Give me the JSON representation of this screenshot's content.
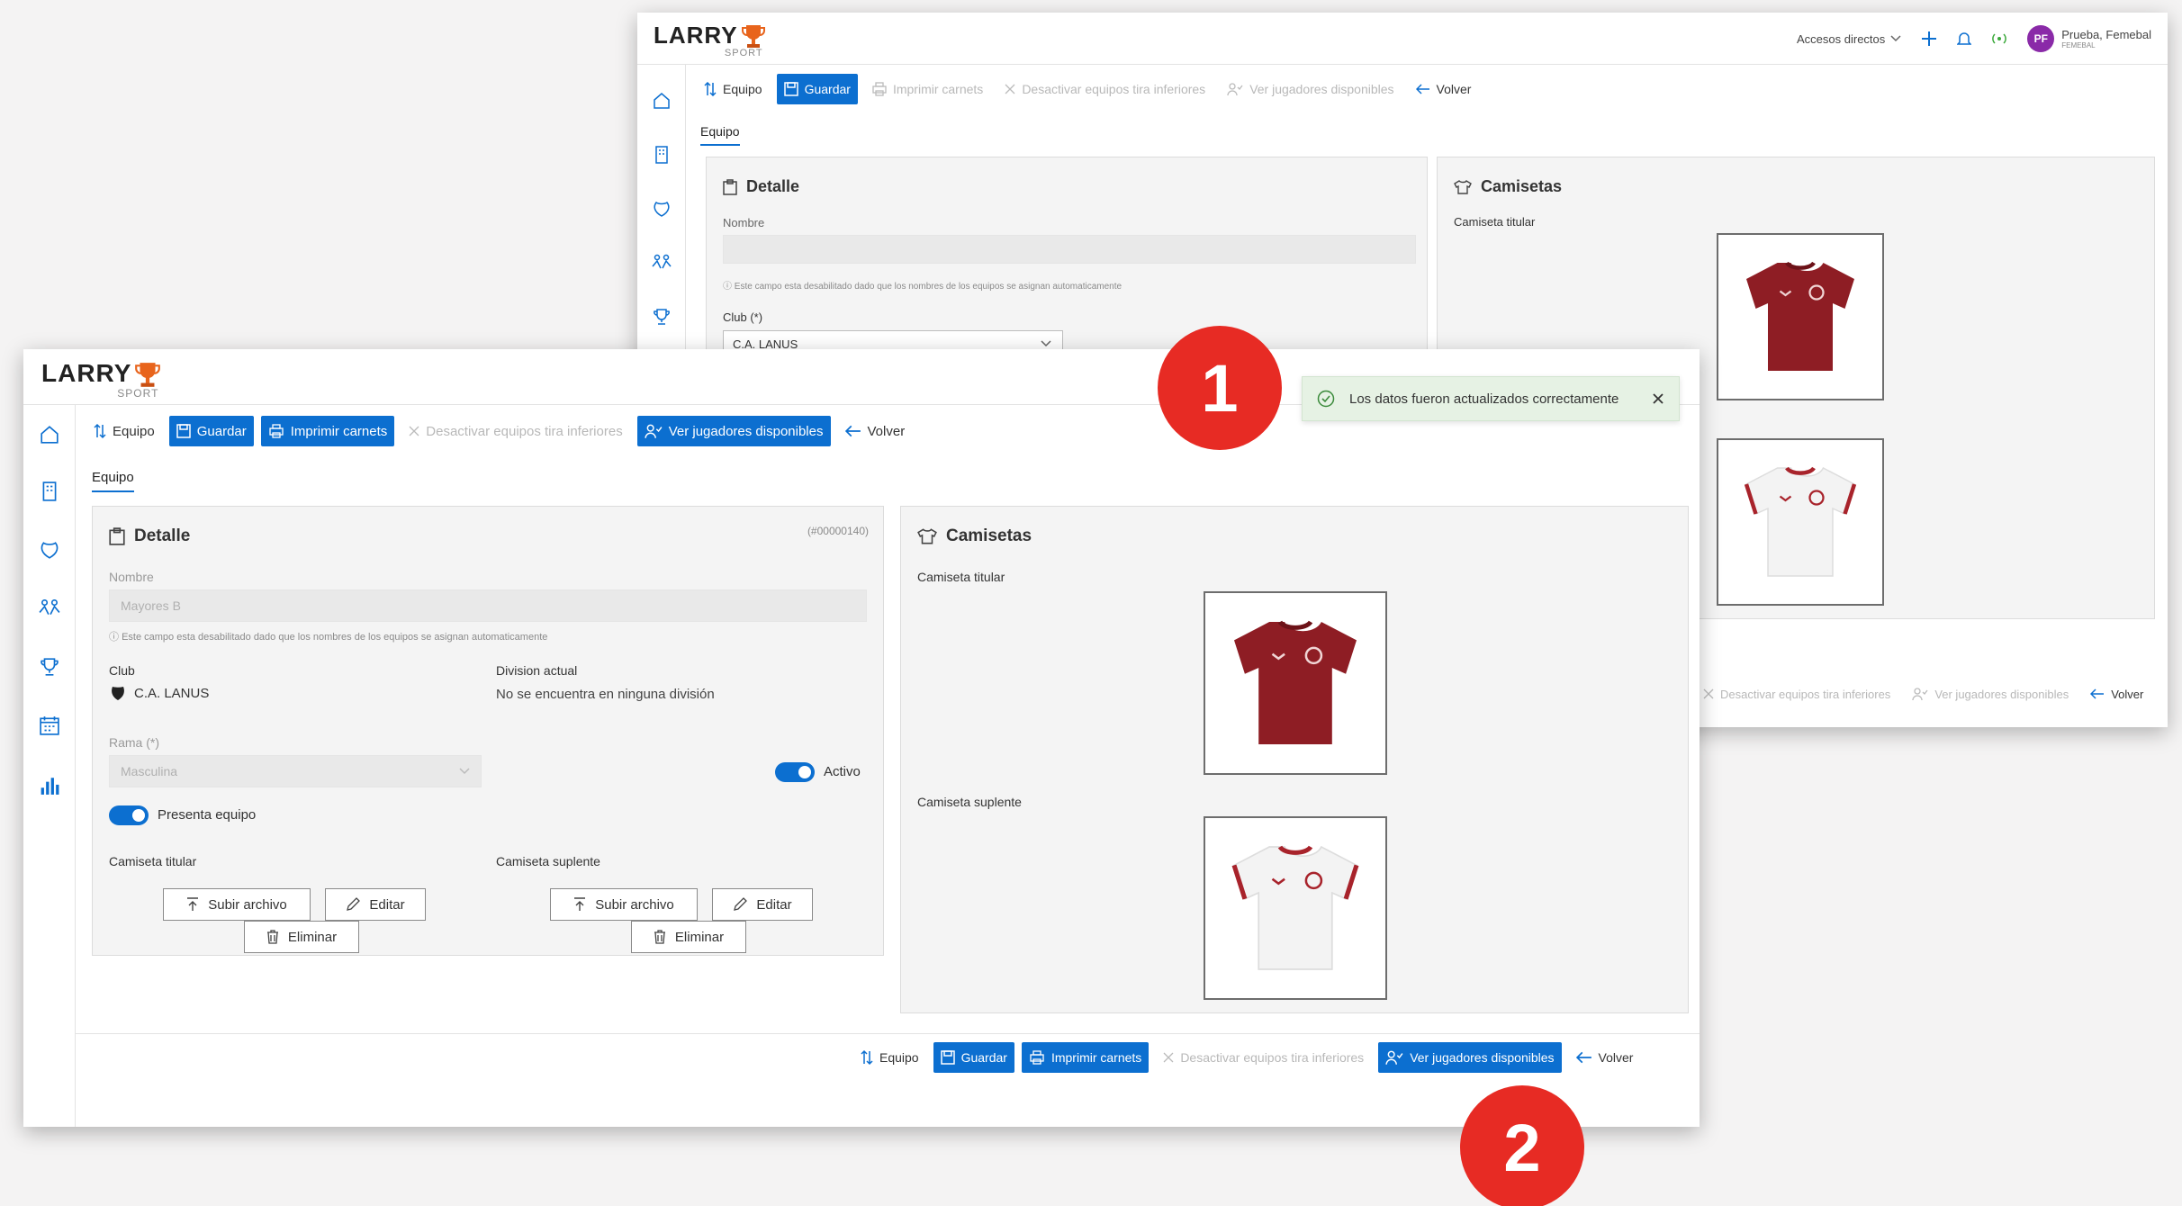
{
  "brand": {
    "name": "LARRY",
    "sub": "SPORT"
  },
  "back_window": {
    "header": {
      "shortcuts": "Accesos directos",
      "avatar": "PF",
      "user_name": "Prueba, Femebal",
      "user_role": "FEMEBAL"
    },
    "toolbar": {
      "equipo": "Equipo",
      "guardar": "Guardar",
      "imprimir": "Imprimir carnets",
      "desactivar": "Desactivar equipos tira inferiores",
      "ver_jugadores": "Ver jugadores disponibles",
      "volver": "Volver"
    },
    "tab": "Equipo",
    "detalle": {
      "title": "Detalle",
      "nombre_label": "Nombre",
      "nombre_help": "Este campo esta desabilitado dado que los nombres de los equipos se asignan automaticamente",
      "club_label": "Club (*)",
      "club_value": "C.A. LANUS"
    },
    "camisetas": {
      "title": "Camisetas",
      "titular_label": "Camiseta titular"
    },
    "bottom_toolbar": {
      "desactivar": "Desactivar equipos tira inferiores",
      "ver_jugadores": "Ver jugadores disponibles",
      "volver": "Volver"
    }
  },
  "front_window": {
    "toolbar": {
      "equipo": "Equipo",
      "guardar": "Guardar",
      "imprimir": "Imprimir carnets",
      "desactivar": "Desactivar equipos tira inferiores",
      "ver_jugadores": "Ver jugadores disponibles",
      "volver": "Volver"
    },
    "tab": "Equipo",
    "detalle": {
      "title": "Detalle",
      "code": "(#00000140)",
      "nombre_label": "Nombre",
      "nombre_value": "Mayores B",
      "nombre_help": "Este campo esta desabilitado dado que los nombres de los equipos se asignan automaticamente",
      "club_label": "Club",
      "club_value": "C.A. LANUS",
      "division_label": "Division actual",
      "division_value": "No se encuentra en ninguna división",
      "rama_label": "Rama (*)",
      "rama_value": "Masculina",
      "activo_label": "Activo",
      "activo_on": true,
      "presenta_label": "Presenta equipo",
      "presenta_on": true,
      "titular_label": "Camiseta titular",
      "suplente_label": "Camiseta suplente",
      "subir": "Subir archivo",
      "editar": "Editar",
      "eliminar": "Eliminar"
    },
    "camisetas": {
      "title": "Camisetas",
      "titular_label": "Camiseta titular",
      "suplente_label": "Camiseta suplente"
    },
    "bottom_toolbar": {
      "equipo": "Equipo",
      "guardar": "Guardar",
      "imprimir": "Imprimir carnets",
      "desactivar": "Desactivar equipos tira inferiores",
      "ver_jugadores": "Ver jugadores disponibles",
      "volver": "Volver"
    }
  },
  "toast": {
    "message": "Los datos fueron actualizados correctamente"
  },
  "badges": {
    "one": "1",
    "two": "2"
  },
  "colors": {
    "primary": "#0c6fd0",
    "badge": "#e72b24",
    "toast_bg": "#e6f2e4",
    "jersey_home": "#8e1d24",
    "jersey_away": "#f3f3f3",
    "avatar": "#8a2aa8"
  }
}
